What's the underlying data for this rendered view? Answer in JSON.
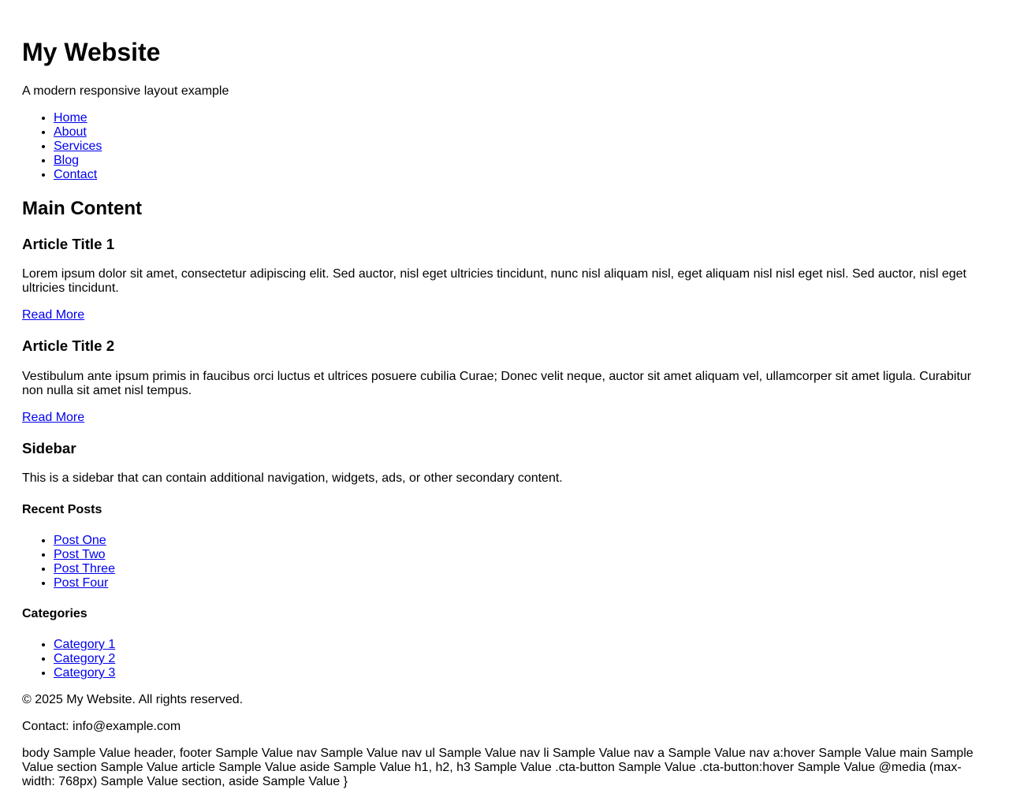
{
  "header": {
    "title": "My Website",
    "tagline": "A modern responsive layout example"
  },
  "nav": {
    "items": [
      "Home",
      "About",
      "Services",
      "Blog",
      "Contact"
    ]
  },
  "main": {
    "title": "Main Content",
    "articles": [
      {
        "title": "Article Title 1",
        "body": "Lorem ipsum dolor sit amet, consectetur adipiscing elit. Sed auctor, nisl eget ultricies tincidunt, nunc nisl aliquam nisl, eget aliquam nisl nisl eget nisl. Sed auctor, nisl eget ultricies tincidunt.",
        "link": "Read More"
      },
      {
        "title": "Article Title 2",
        "body": "Vestibulum ante ipsum primis in faucibus orci luctus et ultrices posuere cubilia Curae; Donec velit neque, auctor sit amet aliquam vel, ullamcorper sit amet ligula. Curabitur non nulla sit amet nisl tempus.",
        "link": "Read More"
      }
    ]
  },
  "sidebar": {
    "title": "Sidebar",
    "text": "This is a sidebar that can contain additional navigation, widgets, ads, or other secondary content.",
    "recent_posts": {
      "title": "Recent Posts",
      "items": [
        "Post One",
        "Post Two",
        "Post Three",
        "Post Four"
      ]
    },
    "categories": {
      "title": "Categories",
      "items": [
        "Category 1",
        "Category 2",
        "Category 3"
      ]
    }
  },
  "footer": {
    "copyright": "© 2025 My Website. All rights reserved.",
    "contact": "Contact: info@example.com",
    "css_text": "body Sample Value header, footer Sample Value nav Sample Value nav ul Sample Value nav li Sample Value nav a Sample Value nav a:hover Sample Value main Sample Value section Sample Value article Sample Value aside Sample Value h1, h2, h3 Sample Value .cta-button Sample Value .cta-button:hover Sample Value @media (max-width: 768px) Sample Value section, aside Sample Value }"
  },
  "colors": {
    "link": "#0000ee",
    "text": "#000000",
    "background": "#ffffff"
  }
}
